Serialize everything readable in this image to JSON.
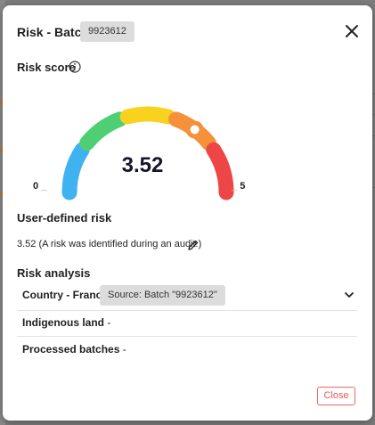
{
  "dialog": {
    "title": "Risk - Batch",
    "batch_id": "9923612"
  },
  "risk_score": {
    "heading": "Risk score",
    "value": "3.52",
    "min_label": "0",
    "max_label": "5",
    "score_fraction": 0.704,
    "segment_colors": [
      "#3fb2ef",
      "#4fcf73",
      "#f8d21e",
      "#f5913b",
      "#ee4646"
    ]
  },
  "user_defined_risk": {
    "heading": "User-defined risk",
    "text": "3.52 (A risk was identified during an audit.)"
  },
  "risk_analysis": {
    "heading": "Risk analysis",
    "rows": [
      {
        "label": "Country - France",
        "value": "",
        "source": "Source: Batch \"9923612\""
      },
      {
        "label": "Indigenous land",
        "value": " -"
      },
      {
        "label": "Processed batches",
        "value": " -"
      }
    ]
  },
  "footer": {
    "close_label": "Close"
  },
  "icons": {
    "close": "close-icon",
    "info": "info-icon",
    "edit": "pencil-icon",
    "expand": "chevron-down-icon"
  }
}
